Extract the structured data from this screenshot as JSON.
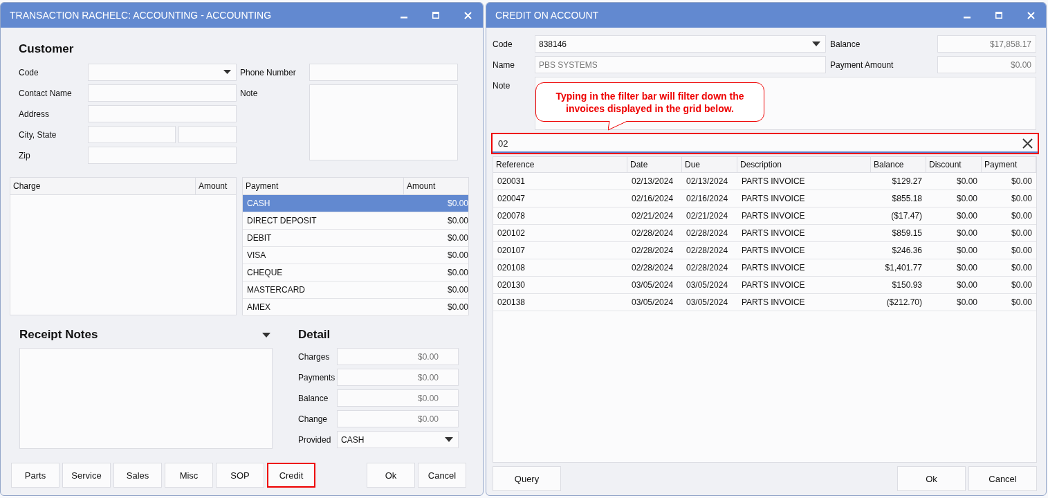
{
  "left_window": {
    "title": "TRANSACTION RACHELC: ACCOUNTING - ACCOUNTING",
    "customer": {
      "heading": "Customer",
      "rows": [
        {
          "label": "Code",
          "kind": "dropdown"
        },
        {
          "label": "Contact Name",
          "kind": "text"
        },
        {
          "label": "Address",
          "kind": "text"
        },
        {
          "label": "City, State",
          "kind": "split"
        },
        {
          "label": "Zip",
          "kind": "text"
        }
      ],
      "phone_label": "Phone Number",
      "note_label": "Note"
    },
    "charge_grid": {
      "columns": [
        "Charge",
        "Amount"
      ]
    },
    "payment_grid": {
      "columns": [
        "Payment",
        "Amount"
      ],
      "rows": [
        {
          "name": "CASH",
          "amount": "$0.00",
          "selected": true
        },
        {
          "name": "DIRECT DEPOSIT",
          "amount": "$0.00",
          "selected": false
        },
        {
          "name": "DEBIT",
          "amount": "$0.00",
          "selected": false
        },
        {
          "name": "VISA",
          "amount": "$0.00",
          "selected": false
        },
        {
          "name": "CHEQUE",
          "amount": "$0.00",
          "selected": false
        },
        {
          "name": "MASTERCARD",
          "amount": "$0.00",
          "selected": false
        },
        {
          "name": "AMEX",
          "amount": "$0.00",
          "selected": false
        }
      ]
    },
    "receipt_notes": {
      "heading": "Receipt Notes"
    },
    "detail": {
      "heading": "Detail",
      "rows": [
        {
          "label": "Charges",
          "value": "$0.00",
          "kind": "amount"
        },
        {
          "label": "Payments",
          "value": "$0.00",
          "kind": "amount"
        },
        {
          "label": "Balance",
          "value": "$0.00",
          "kind": "amount"
        },
        {
          "label": "Change",
          "value": "$0.00",
          "kind": "amount"
        },
        {
          "label": "Provided",
          "value": "CASH",
          "kind": "dropdown"
        }
      ]
    },
    "buttons": [
      {
        "label": "Parts",
        "highlighted": false
      },
      {
        "label": "Service",
        "highlighted": false
      },
      {
        "label": "Sales",
        "highlighted": false
      },
      {
        "label": "Misc",
        "highlighted": false
      },
      {
        "label": "SOP",
        "highlighted": false
      },
      {
        "label": "Credit",
        "highlighted": true
      }
    ],
    "dialog_buttons": [
      "Ok",
      "Cancel"
    ]
  },
  "right_window": {
    "title": "CREDIT ON ACCOUNT",
    "code": {
      "label": "Code",
      "value": "838146"
    },
    "name": {
      "label": "Name",
      "value": "PBS SYSTEMS"
    },
    "balance": {
      "label": "Balance",
      "value": "$17,858.17"
    },
    "payment_amount": {
      "label": "Payment Amount",
      "value": "$0.00"
    },
    "note_label": "Note",
    "callout": "Typing in the filter bar will filter down the invoices displayed in the grid below.",
    "filter": {
      "value": "02",
      "highlighted": true
    },
    "grid": {
      "columns": [
        {
          "label": "Reference",
          "kind": "text"
        },
        {
          "label": "Date",
          "kind": "text"
        },
        {
          "label": "Due",
          "kind": "text"
        },
        {
          "label": "Description",
          "kind": "text"
        },
        {
          "label": "Balance",
          "kind": "amount"
        },
        {
          "label": "Discount",
          "kind": "amount"
        },
        {
          "label": "Payment",
          "kind": "amount"
        }
      ],
      "rows": [
        [
          "020031",
          "02/13/2024",
          "02/13/2024",
          "PARTS INVOICE",
          "$129.27",
          "$0.00",
          "$0.00"
        ],
        [
          "020047",
          "02/16/2024",
          "02/16/2024",
          "PARTS INVOICE",
          "$855.18",
          "$0.00",
          "$0.00"
        ],
        [
          "020078",
          "02/21/2024",
          "02/21/2024",
          "PARTS INVOICE",
          "($17.47)",
          "$0.00",
          "$0.00"
        ],
        [
          "020102",
          "02/28/2024",
          "02/28/2024",
          "PARTS INVOICE",
          "$859.15",
          "$0.00",
          "$0.00"
        ],
        [
          "020107",
          "02/28/2024",
          "02/28/2024",
          "PARTS INVOICE",
          "$246.36",
          "$0.00",
          "$0.00"
        ],
        [
          "020108",
          "02/28/2024",
          "02/28/2024",
          "PARTS INVOICE",
          "$1,401.77",
          "$0.00",
          "$0.00"
        ],
        [
          "020130",
          "03/05/2024",
          "03/05/2024",
          "PARTS INVOICE",
          "$150.93",
          "$0.00",
          "$0.00"
        ],
        [
          "020138",
          "03/05/2024",
          "03/05/2024",
          "PARTS INVOICE",
          "($212.70)",
          "$0.00",
          "$0.00"
        ]
      ]
    },
    "left_buttons": [
      "Query"
    ],
    "right_buttons": [
      "Ok",
      "Cancel"
    ]
  }
}
